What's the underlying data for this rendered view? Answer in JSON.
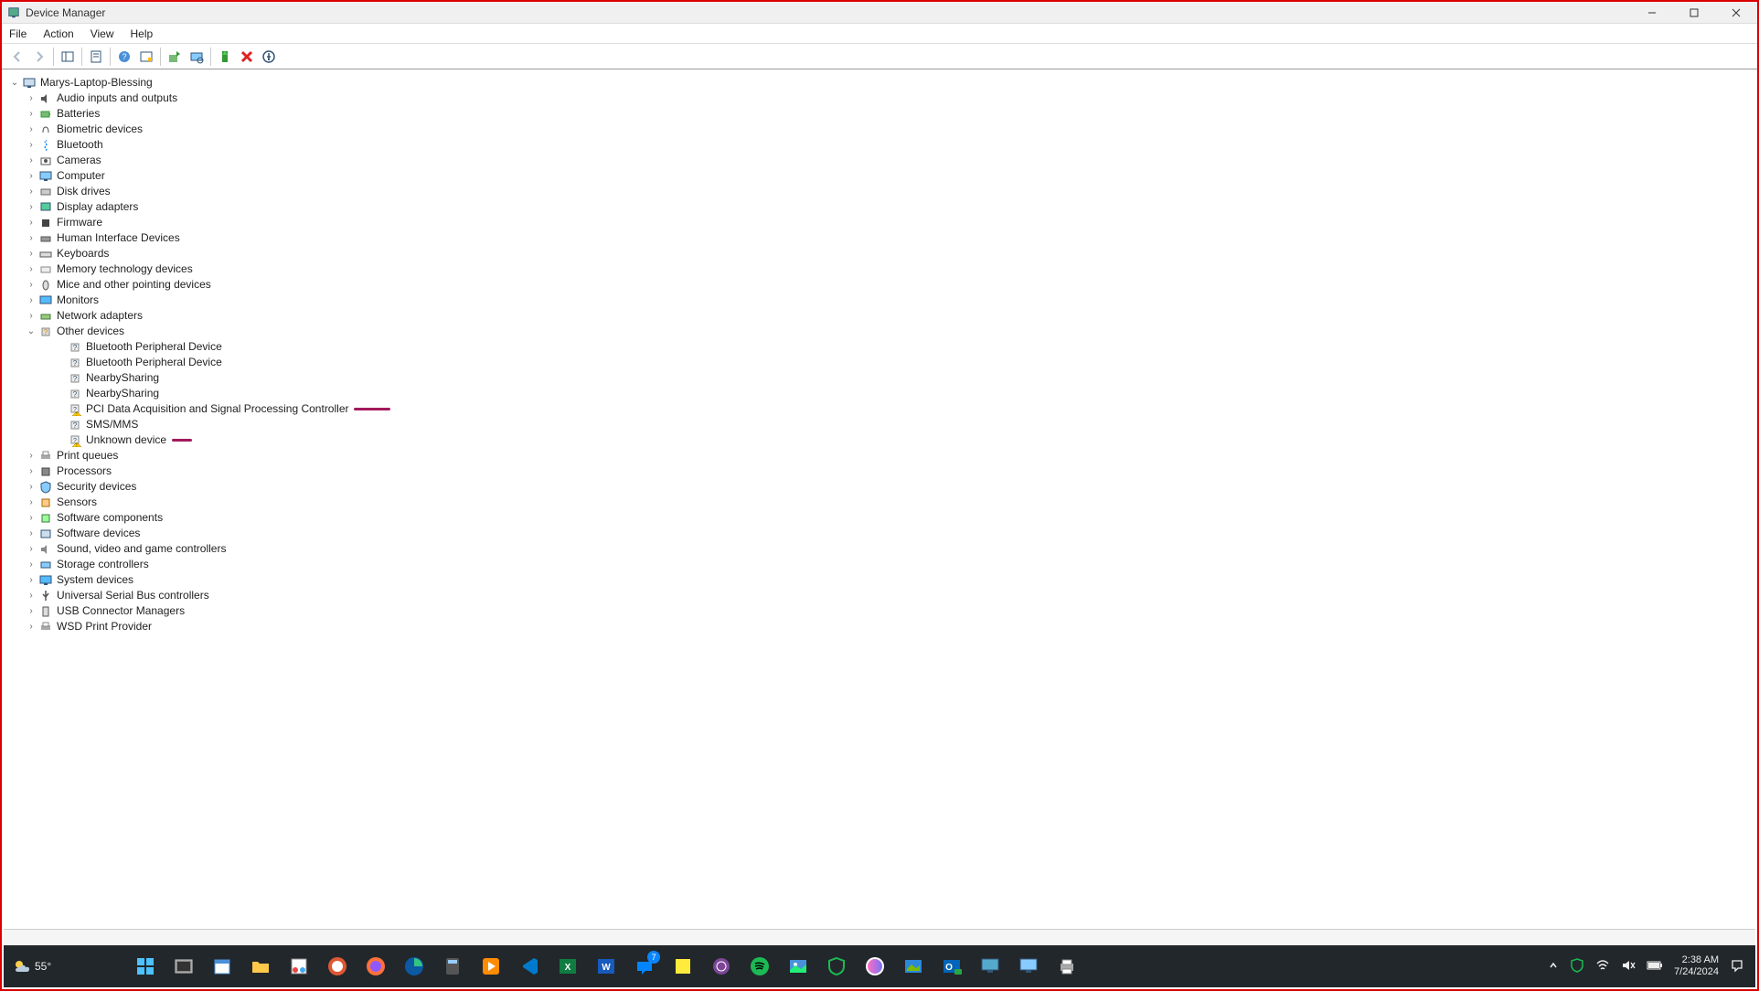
{
  "window": {
    "title": "Device Manager"
  },
  "menubar": {
    "file": "File",
    "action": "Action",
    "view": "View",
    "help": "Help"
  },
  "root": {
    "label": "Marys-Laptop-Blessing"
  },
  "categories": [
    {
      "label": "Audio inputs and outputs",
      "expanded": false
    },
    {
      "label": "Batteries",
      "expanded": false
    },
    {
      "label": "Biometric devices",
      "expanded": false
    },
    {
      "label": "Bluetooth",
      "expanded": false
    },
    {
      "label": "Cameras",
      "expanded": false
    },
    {
      "label": "Computer",
      "expanded": false
    },
    {
      "label": "Disk drives",
      "expanded": false
    },
    {
      "label": "Display adapters",
      "expanded": false
    },
    {
      "label": "Firmware",
      "expanded": false
    },
    {
      "label": "Human Interface Devices",
      "expanded": false
    },
    {
      "label": "Keyboards",
      "expanded": false
    },
    {
      "label": "Memory technology devices",
      "expanded": false
    },
    {
      "label": "Mice and other pointing devices",
      "expanded": false
    },
    {
      "label": "Monitors",
      "expanded": false
    },
    {
      "label": "Network adapters",
      "expanded": false
    },
    {
      "label": "Other devices",
      "expanded": true
    },
    {
      "label": "Print queues",
      "expanded": false
    },
    {
      "label": "Processors",
      "expanded": false
    },
    {
      "label": "Security devices",
      "expanded": false
    },
    {
      "label": "Sensors",
      "expanded": false
    },
    {
      "label": "Software components",
      "expanded": false
    },
    {
      "label": "Software devices",
      "expanded": false
    },
    {
      "label": "Sound, video and game controllers",
      "expanded": false
    },
    {
      "label": "Storage controllers",
      "expanded": false
    },
    {
      "label": "System devices",
      "expanded": false
    },
    {
      "label": "Universal Serial Bus controllers",
      "expanded": false
    },
    {
      "label": "USB Connector Managers",
      "expanded": false
    },
    {
      "label": "WSD Print Provider",
      "expanded": false
    }
  ],
  "other_devices": [
    {
      "label": "Bluetooth Peripheral Device",
      "warning": false,
      "mark": ""
    },
    {
      "label": "Bluetooth Peripheral Device",
      "warning": false,
      "mark": ""
    },
    {
      "label": "NearbySharing",
      "warning": false,
      "mark": ""
    },
    {
      "label": "NearbySharing",
      "warning": false,
      "mark": ""
    },
    {
      "label": "PCI Data Acquisition and Signal Processing Controller",
      "warning": true,
      "mark": "long"
    },
    {
      "label": "SMS/MMS",
      "warning": false,
      "mark": ""
    },
    {
      "label": "Unknown device",
      "warning": true,
      "mark": "short"
    }
  ],
  "taskbar": {
    "weather_temp": "55°",
    "clock_time": "2:38 AM",
    "clock_date": "7/24/2024",
    "messenger_badge": "7"
  }
}
